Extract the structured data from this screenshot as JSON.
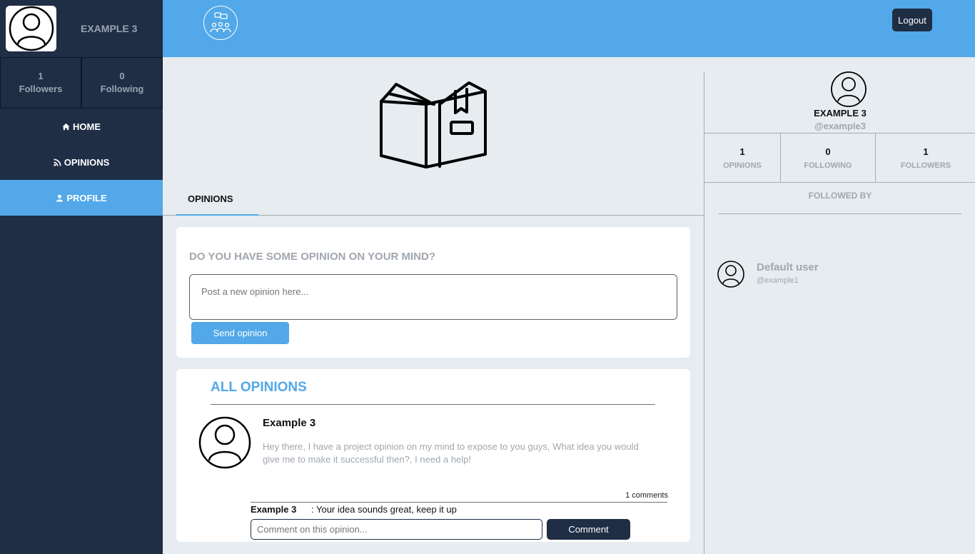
{
  "sidebar": {
    "user_name": "EXAMPLE 3",
    "stats": [
      {
        "count": "1",
        "label": "Followers"
      },
      {
        "count": "0",
        "label": "Following"
      }
    ],
    "nav": [
      {
        "label": "HOME",
        "icon": "home-icon"
      },
      {
        "label": "OPINIONS",
        "icon": "rss-icon"
      },
      {
        "label": "PROFILE",
        "icon": "user-icon",
        "active": true
      }
    ]
  },
  "header": {
    "logout_label": "Logout",
    "logo_icon": "community-chat-icon"
  },
  "main": {
    "hero_icon": "open-book-icon",
    "tabs": [
      {
        "label": "OPINIONS",
        "active": true
      }
    ],
    "composer": {
      "heading": "DO YOU HAVE SOME OPINION ON YOUR MIND?",
      "placeholder": "Post a new opinion here...",
      "send_label": "Send opinion"
    },
    "feed": {
      "title": "ALL OPINIONS",
      "opinions": [
        {
          "author": "Example 3",
          "text": "Hey there, I have a project opinion on my mind to expose to you guys, What idea you would give me to make it successful then?, I need a help!",
          "comments_count": "1 comments",
          "comments": [
            {
              "author": "Example 3",
              "text": ": Your idea sounds great, keep it up"
            }
          ],
          "comment_placeholder": "Comment on this opinion...",
          "comment_button": "Comment"
        }
      ]
    }
  },
  "profile_panel": {
    "name": "EXAMPLE 3",
    "handle": "@example3",
    "stats": [
      {
        "count": "1",
        "label": "OPINIONS"
      },
      {
        "count": "0",
        "label": "FOLLOWING"
      },
      {
        "count": "1",
        "label": "FOLLOWERS"
      }
    ],
    "followed_by_label": "FOLLOWED BY",
    "followers": [
      {
        "name": "Default user",
        "handle": "@example1"
      }
    ]
  },
  "colors": {
    "sidebar": "#1f2d45",
    "accent": "#52a8e8",
    "background": "#e6ecef"
  }
}
